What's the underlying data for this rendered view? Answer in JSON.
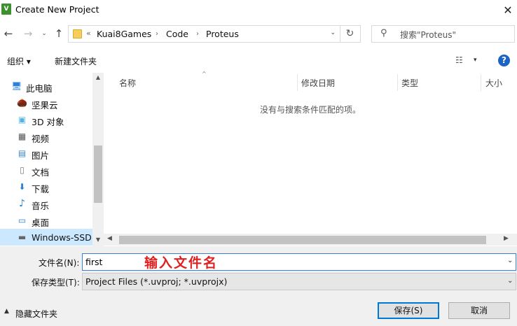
{
  "window": {
    "icon_text": "V",
    "title": "Create New Project",
    "close_glyph": "✕"
  },
  "navbar": {
    "back_glyph": "←",
    "forward_glyph": "→",
    "recent_glyph": "⌄",
    "up_glyph": "↑",
    "breadcrumb_more": "«",
    "breadcrumbs": [
      "Kuai8Games",
      "Code",
      "Proteus"
    ],
    "crumb_sep": "›",
    "dropdown_glyph": "⌄",
    "refresh_glyph": "↻",
    "search_glyph": "⚲",
    "search_placeholder": "搜索\"Proteus\""
  },
  "toolbar": {
    "organize_label": "组织 ▾",
    "new_folder_label": "新建文件夹",
    "view_glyph": "☷",
    "view_arrow": "▾",
    "help_glyph": "?"
  },
  "sidebar": {
    "items": [
      {
        "label": "此电脑",
        "icon": "computer-icon",
        "glyph": "🖥"
      },
      {
        "label": "坚果云",
        "icon": "nutstore-icon",
        "glyph": "🌰"
      },
      {
        "label": "3D 对象",
        "icon": "3d-objects-icon",
        "glyph": "▣"
      },
      {
        "label": "视频",
        "icon": "video-icon",
        "glyph": "▦"
      },
      {
        "label": "图片",
        "icon": "picture-icon",
        "glyph": "▤"
      },
      {
        "label": "文档",
        "icon": "document-icon",
        "glyph": "▯"
      },
      {
        "label": "下载",
        "icon": "download-icon",
        "glyph": "⬇"
      },
      {
        "label": "音乐",
        "icon": "music-icon",
        "glyph": "♪"
      },
      {
        "label": "桌面",
        "icon": "desktop-icon",
        "glyph": "▭"
      },
      {
        "label": "Windows-SSD",
        "icon": "drive-icon",
        "glyph": "▬"
      }
    ],
    "scroll_up": "▲",
    "scroll_down": "▼"
  },
  "file_list": {
    "sort_glyph": "^",
    "columns": [
      "名称",
      "修改日期",
      "类型",
      "大小"
    ],
    "empty_message": "没有与搜索条件匹配的项。",
    "scroll_left": "◀",
    "scroll_right": "▶"
  },
  "form": {
    "filename_label": "文件名(N):",
    "filename_value": "first",
    "annotation": "输入文件名",
    "filetype_label": "保存类型(T):",
    "filetype_value": "Project Files (*.uvproj; *.uvprojx)",
    "dropdown_glyph": "⌄",
    "hide_folders_arrow": "▲",
    "hide_folders_label": "隐藏文件夹",
    "save_label": "保存(S)",
    "cancel_label": "取消"
  },
  "colors": {
    "accent": "#0078d7",
    "annotation": "#e02020",
    "selection": "#cce8ff"
  }
}
